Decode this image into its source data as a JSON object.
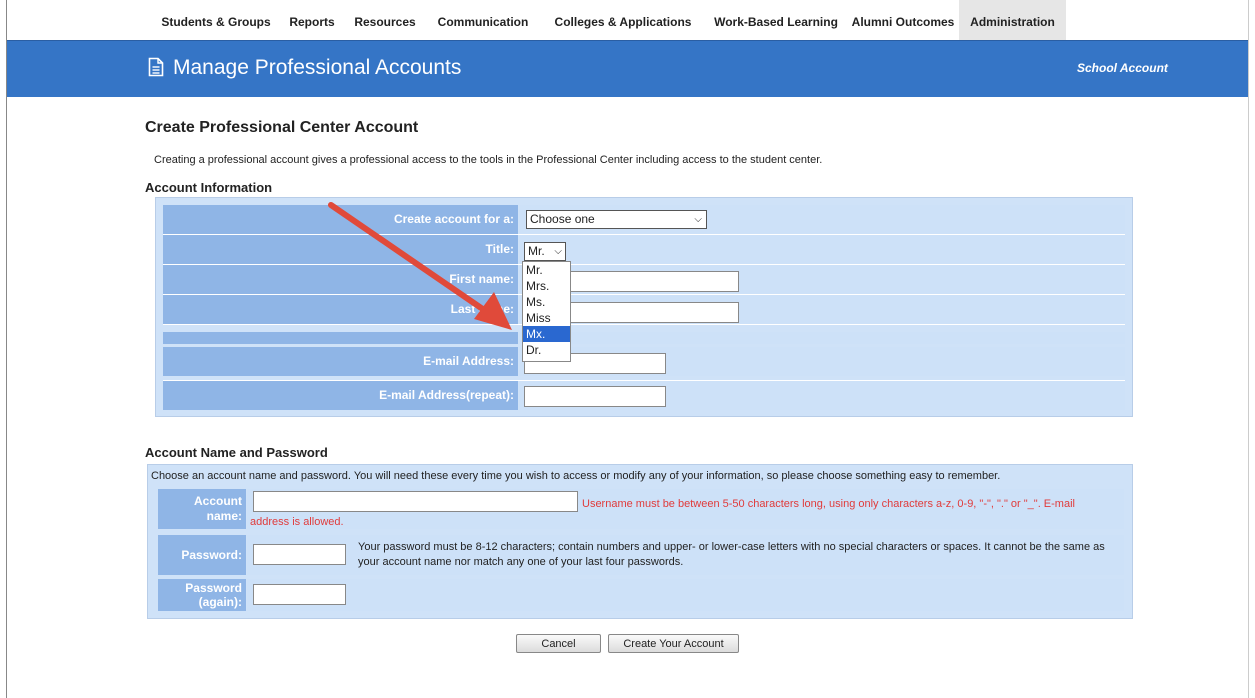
{
  "nav": {
    "items": [
      {
        "label": "Students & Groups"
      },
      {
        "label": "Reports"
      },
      {
        "label": "Resources"
      },
      {
        "label": "Communication"
      },
      {
        "label": "Colleges & Applications"
      },
      {
        "label": "Work-Based Learning"
      },
      {
        "label": "Alumni Outcomes"
      },
      {
        "label": "Administration"
      }
    ],
    "active": "Administration"
  },
  "banner": {
    "title": "Manage Professional Accounts",
    "account_label": "School Account",
    "icon": "document-icon",
    "color": "#3575c6"
  },
  "page": {
    "title": "Create Professional Center Account",
    "intro": "Creating a professional account gives a professional access to the tools in the Professional Center including access to the student center."
  },
  "account_info": {
    "heading": "Account Information",
    "create_for_label": "Create account for a:",
    "create_for_value": "Choose one",
    "title_label": "Title:",
    "title_value": "Mr.",
    "title_options": [
      "Mr.",
      "Mrs.",
      "Ms.",
      "Miss",
      "Mx.",
      "Dr."
    ],
    "title_highlighted": "Mx.",
    "first_name_label": "First name:",
    "last_name_label": "Last name:",
    "email_label": "E-mail Address:",
    "email_repeat_label": "E-mail Address(repeat):"
  },
  "account_name_password": {
    "heading": "Account Name and Password",
    "description": "Choose an account name and password. You will need these every time you wish to access or modify any of your information, so please choose something easy to remember.",
    "account_name_label": "Account name:",
    "account_name_error": "Username must be between 5-50 characters long, using only characters a-z, 0-9, \"-\", \".\" or \"_\". E-mail address is allowed.",
    "password_label": "Password:",
    "password_note": "Your password must be 8-12 characters; contain numbers and upper- or lower-case letters with no special characters or spaces. It cannot be the same as your account name nor match any one of your last four passwords.",
    "password_again_label": "Password (again):"
  },
  "buttons": {
    "cancel": "Cancel",
    "create": "Create Your Account"
  },
  "colors": {
    "label_bg": "#8fb5e6",
    "panel_bg": "#cfe2f8",
    "error": "#e03b3b",
    "annotation_arrow": "#e04a3a"
  }
}
